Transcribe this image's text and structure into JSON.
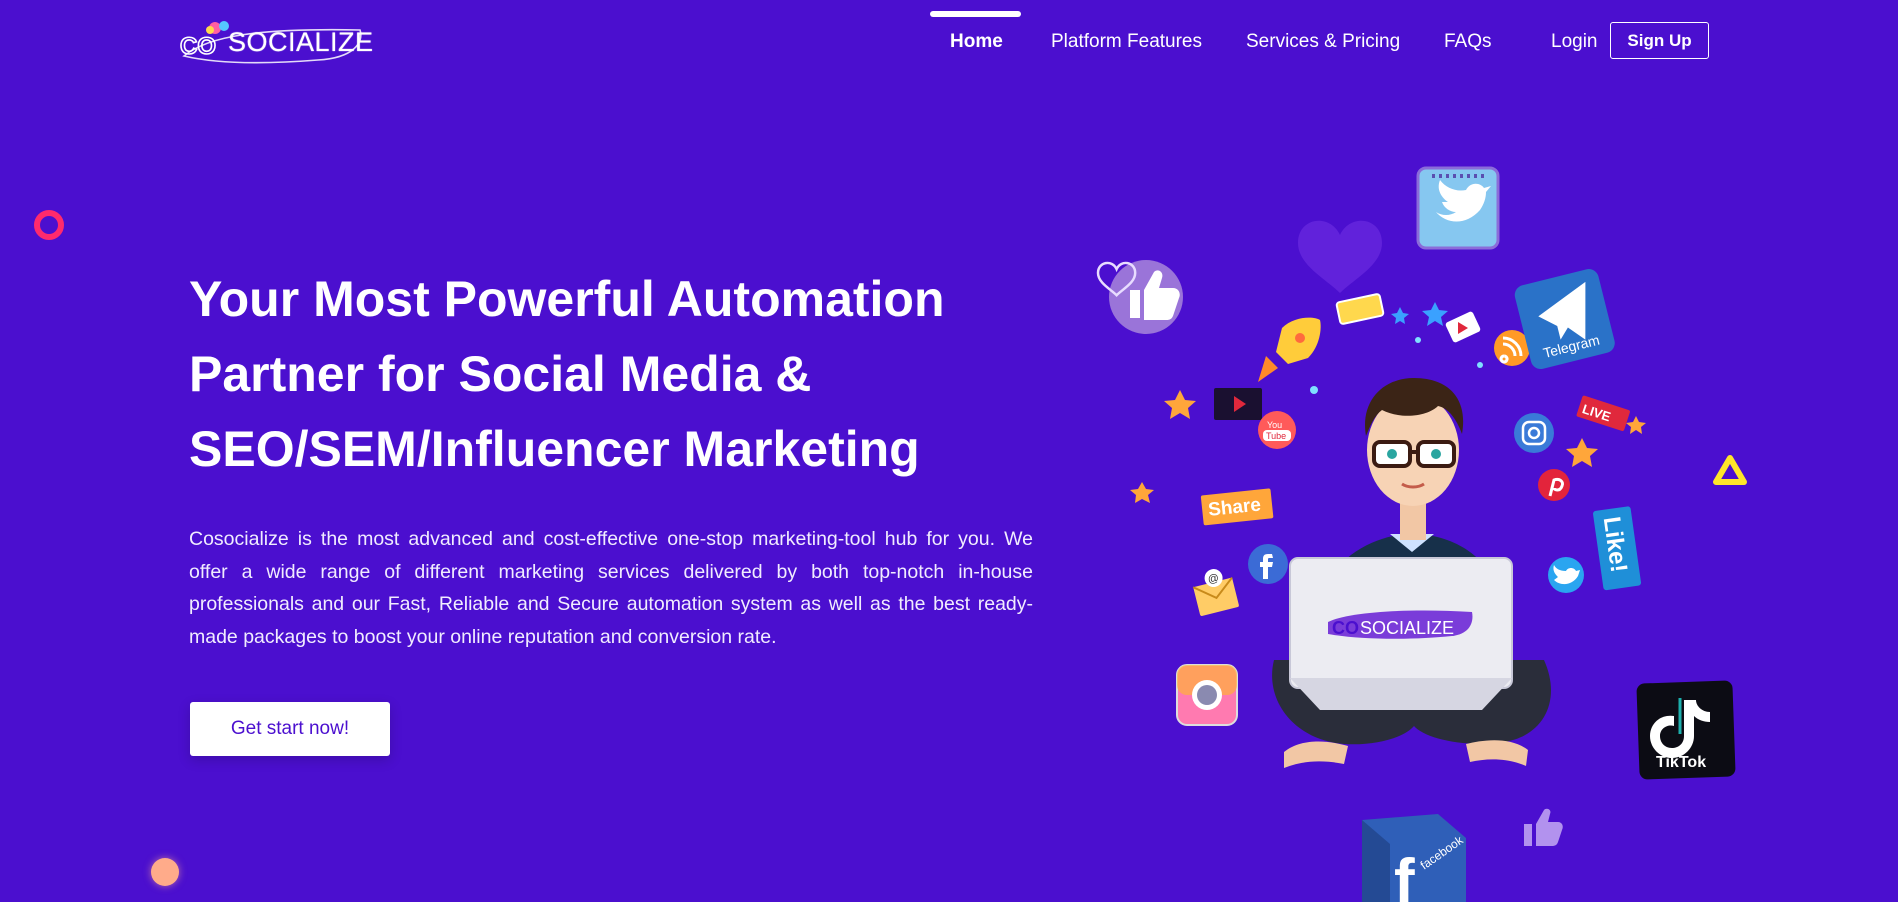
{
  "header": {
    "logo_text": "SOCIALIZE",
    "logo_prefix": "CO",
    "nav": [
      {
        "label": "Home",
        "active": true
      },
      {
        "label": "Platform Features"
      },
      {
        "label": "Services & Pricing"
      },
      {
        "label": "FAQs"
      }
    ],
    "login_label": "Login",
    "signup_label": "Sign Up"
  },
  "hero": {
    "title_lines": [
      "Your Most Powerful Automation",
      "Partner for Social Media &",
      "SEO/SEM/Influencer Marketing"
    ],
    "description": "Cosocialize is the most advanced and cost-effective one-stop marketing-tool hub for you. We offer a wide range of different marketing services delivered by both top-notch in-house professionals and our Fast, Reliable and Secure automation system as well as the best ready-made packages to boost your online reputation and conversion rate.",
    "cta_label": "Get start now!"
  },
  "illustration": {
    "laptop_logo_prefix": "CO",
    "laptop_logo_text": "SOCIALIZE",
    "stickers": {
      "share": "Share",
      "live": "LIVE",
      "like": "Like!",
      "telegram": "Telegram",
      "tiktok": "TikTok",
      "facebook": "facebook",
      "youtube_top": "You",
      "youtube_bottom": "Tube"
    }
  },
  "colors": {
    "background": "#4b0fcf",
    "cta_text": "#4b0fcf",
    "ring": "#ff2a6d",
    "peach_dot": "#ffab8a"
  }
}
